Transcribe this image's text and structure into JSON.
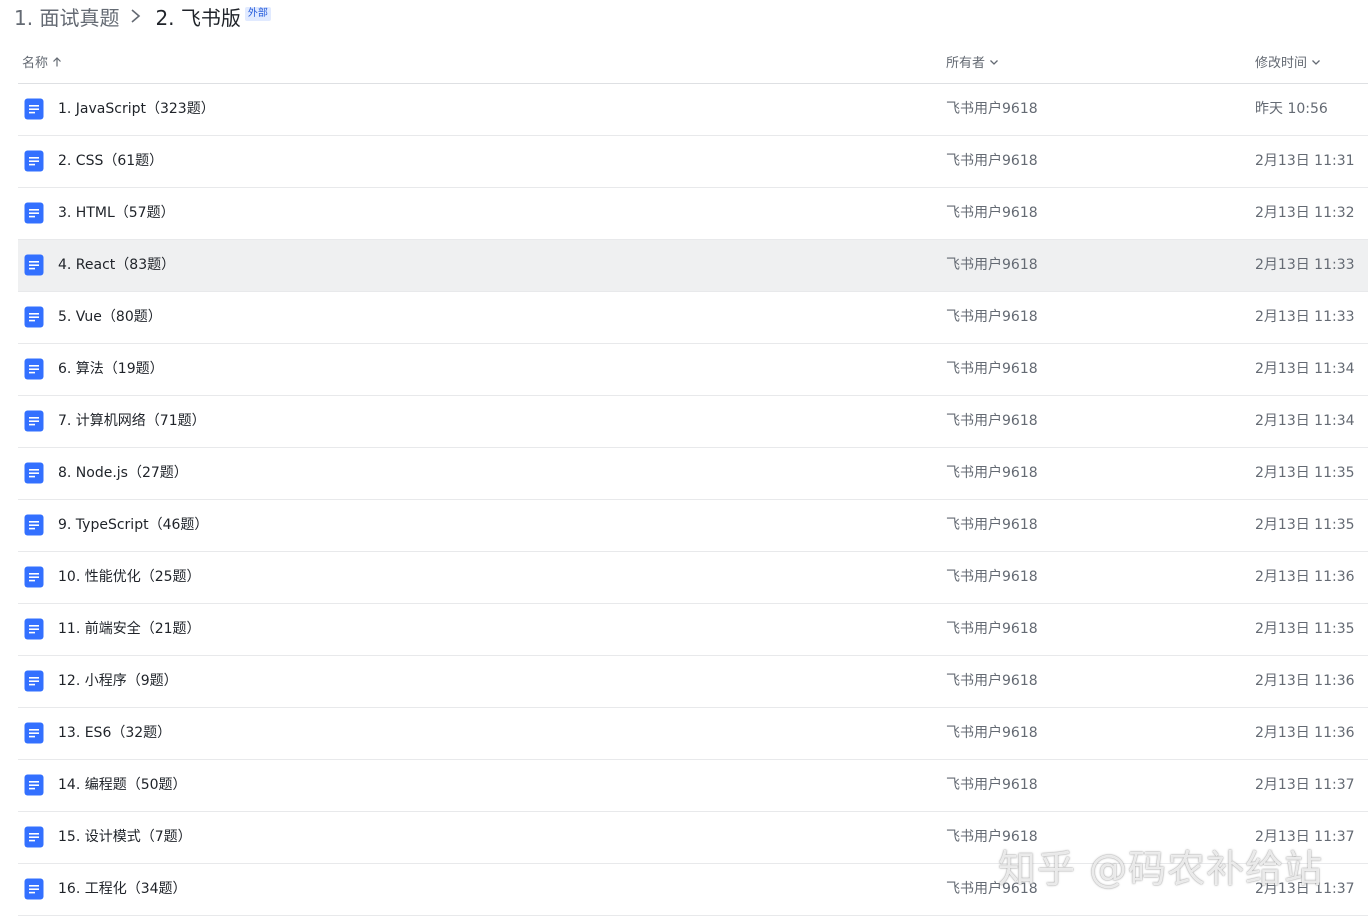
{
  "breadcrumb": {
    "parent": "1. 面试真题",
    "current": "2. 飞书版",
    "tag": "外部"
  },
  "columns": {
    "name": "名称",
    "owner": "所有者",
    "modified": "修改时间"
  },
  "rows": [
    {
      "name": "1. JavaScript（323题）",
      "owner": "飞书用户9618",
      "time": "昨天 10:56"
    },
    {
      "name": "2. CSS（61题）",
      "owner": "飞书用户9618",
      "time": "2月13日 11:31"
    },
    {
      "name": "3. HTML（57题）",
      "owner": "飞书用户9618",
      "time": "2月13日 11:32"
    },
    {
      "name": "4. React（83题）",
      "owner": "飞书用户9618",
      "time": "2月13日 11:33"
    },
    {
      "name": "5. Vue（80题）",
      "owner": "飞书用户9618",
      "time": "2月13日 11:33"
    },
    {
      "name": "6. 算法（19题）",
      "owner": "飞书用户9618",
      "time": "2月13日 11:34"
    },
    {
      "name": "7. 计算机网络（71题）",
      "owner": "飞书用户9618",
      "time": "2月13日 11:34"
    },
    {
      "name": "8. Node.js（27题）",
      "owner": "飞书用户9618",
      "time": "2月13日 11:35"
    },
    {
      "name": "9. TypeScript（46题）",
      "owner": "飞书用户9618",
      "time": "2月13日 11:35"
    },
    {
      "name": "10. 性能优化（25题）",
      "owner": "飞书用户9618",
      "time": "2月13日 11:36"
    },
    {
      "name": "11. 前端安全（21题）",
      "owner": "飞书用户9618",
      "time": "2月13日 11:35"
    },
    {
      "name": "12. 小程序（9题）",
      "owner": "飞书用户9618",
      "time": "2月13日 11:36"
    },
    {
      "name": "13. ES6（32题）",
      "owner": "飞书用户9618",
      "time": "2月13日 11:36"
    },
    {
      "name": "14. 编程题（50题）",
      "owner": "飞书用户9618",
      "time": "2月13日 11:37"
    },
    {
      "name": "15. 设计模式（7题）",
      "owner": "飞书用户9618",
      "time": "2月13日 11:37"
    },
    {
      "name": "16. 工程化（34题）",
      "owner": "飞书用户9618",
      "time": "2月13日 11:37"
    }
  ],
  "hovered_row": 3,
  "watermark": "知乎 @码农补给站",
  "colors": {
    "doc_icon": "#3370ff",
    "hover_row": "#eff0f1",
    "tag_text": "#245bdb",
    "tag_bg": "#e1eaff"
  }
}
